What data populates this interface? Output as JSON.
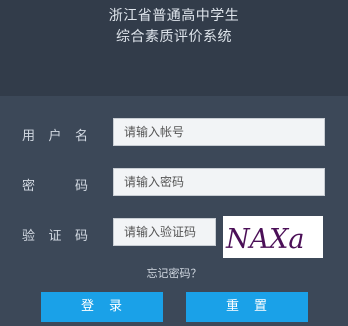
{
  "header": {
    "title_line1": "浙江省普通高中学生",
    "title_line2": "综合素质评价系统"
  },
  "form": {
    "username_label": [
      "用",
      "户",
      "名"
    ],
    "password_label": [
      "密",
      "码"
    ],
    "captcha_label": [
      "验",
      "证",
      "码"
    ],
    "username_placeholder": "请输入帐号",
    "password_placeholder": "请输入密码",
    "captcha_placeholder": "请输入验证码",
    "captcha_image_text": "NAXa",
    "forgot_link": "忘记密码？",
    "login_button": "登　录",
    "reset_button": "重　置"
  },
  "colors": {
    "background": "#3b4756",
    "header_bg": "#323c4a",
    "button": "#1aa1e8",
    "captcha_text": "#4b0f57"
  }
}
